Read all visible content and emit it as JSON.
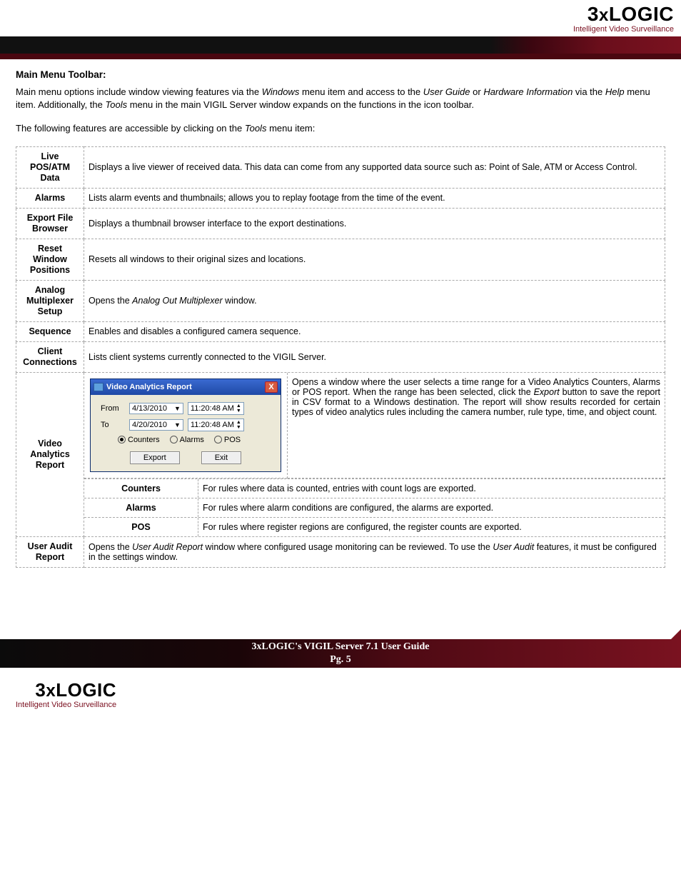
{
  "brand": {
    "name_prefix": "3",
    "name_x": "x",
    "name_suffix": "LOGIC",
    "tagline": "Intelligent Video Surveillance"
  },
  "heading": "Main Menu Toolbar:",
  "intro": {
    "p1_a": "Main menu options include window viewing features via the ",
    "p1_em1": "Windows",
    "p1_b": " menu item and access to the ",
    "p1_em2": "User Guide",
    "p1_c": " or ",
    "p1_em3": "Hardware Information",
    "p1_d": " via the ",
    "p1_em4": "Help",
    "p1_e": " menu item. Additionally, the ",
    "p1_em5": "Tools",
    "p1_f": " menu in the main VIGIL Server window expands on the functions in the icon toolbar."
  },
  "intro2_a": "The following features are accessible by clicking on the ",
  "intro2_em": "Tools",
  "intro2_b": " menu item:",
  "rows": {
    "live": {
      "label": "Live POS/ATM Data",
      "desc": "Displays a live viewer of received data.  This data can come from any supported data source such as: Point of Sale, ATM or Access Control."
    },
    "alarms": {
      "label": "Alarms",
      "desc": "Lists alarm events and thumbnails; allows you to replay footage from the time of the event."
    },
    "export": {
      "label": "Export File Browser",
      "desc": "Displays a thumbnail browser interface to the export destinations."
    },
    "reset": {
      "label": "Reset Window Positions",
      "desc": "Resets all windows to their original sizes and locations."
    },
    "analog": {
      "label": "Analog Multiplexer Setup",
      "desc_a": "Opens the ",
      "desc_em": "Analog Out Multiplexer",
      "desc_b": " window."
    },
    "sequence": {
      "label": "Sequence",
      "desc": "Enables and disables a configured camera sequence."
    },
    "client": {
      "label": "Client Connections",
      "desc": "Lists client systems currently connected to the VIGIL Server."
    },
    "var": {
      "label": "Video Analytics Report",
      "desc_a": "Opens a window where the user selects a time range for a Video Analytics Counters, Alarms or POS report. When the range has been selected, click the ",
      "desc_em": "Export",
      "desc_b": " button to save the report in CSV format to a Windows destination. The report will show results recorded for certain types of video analytics rules including the camera number, rule type, time, and object count.",
      "sub": {
        "counters": {
          "label": "Counters",
          "desc": "For rules where data is counted, entries with count logs are exported."
        },
        "alarms": {
          "label": "Alarms",
          "desc": "For rules where alarm conditions are configured, the alarms are exported."
        },
        "pos": {
          "label": "POS",
          "desc": "For rules where register regions are configured, the register counts are exported."
        }
      }
    },
    "audit": {
      "label": "User Audit Report",
      "desc_a": "Opens the ",
      "desc_em1": "User Audit Report",
      "desc_b": " window where configured usage monitoring can be reviewed.  To use the ",
      "desc_em2": "User Audit",
      "desc_c": " features, it must be configured in the settings window."
    }
  },
  "dialog": {
    "title": "Video Analytics Report",
    "from_label": "From",
    "to_label": "To",
    "from_date": "4/13/2010",
    "to_date": "4/20/2010",
    "from_time": "11:20:48 AM",
    "to_time": "11:20:48 AM",
    "radio_counters": "Counters",
    "radio_alarms": "Alarms",
    "radio_pos": "POS",
    "btn_export": "Export",
    "btn_exit": "Exit"
  },
  "footer": {
    "title": "3xLOGIC's VIGIL Server 7.1 User Guide",
    "page": "Pg. 5"
  }
}
